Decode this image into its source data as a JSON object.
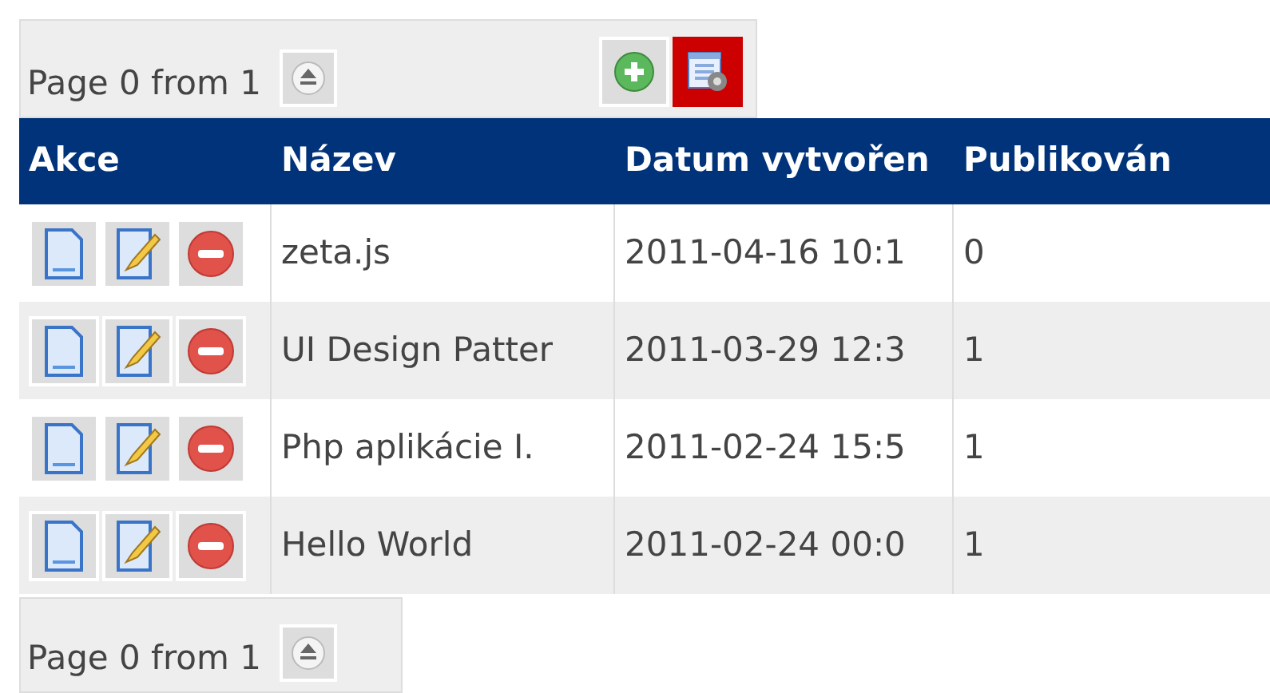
{
  "top_pager": {
    "label": "Page 0 from 1"
  },
  "toolbar": [
    {
      "kind": "add",
      "active": false
    },
    {
      "kind": "settings",
      "active": true
    }
  ],
  "table": {
    "columns": [
      "Akce",
      "Název",
      "Datum vytvořen",
      "Publikován"
    ],
    "rows": [
      {
        "name": "zeta.js",
        "created": "2011-04-16 10:1",
        "published": "0"
      },
      {
        "name": "UI Design Patter",
        "created": "2011-03-29 12:3",
        "published": "1"
      },
      {
        "name": "Php aplikácie I.",
        "created": "2011-02-24 15:5",
        "published": "1"
      },
      {
        "name": "Hello World",
        "created": "2011-02-24 00:0",
        "published": "1"
      }
    ]
  },
  "bottom_pager": {
    "label": "Page 0 from 1"
  }
}
